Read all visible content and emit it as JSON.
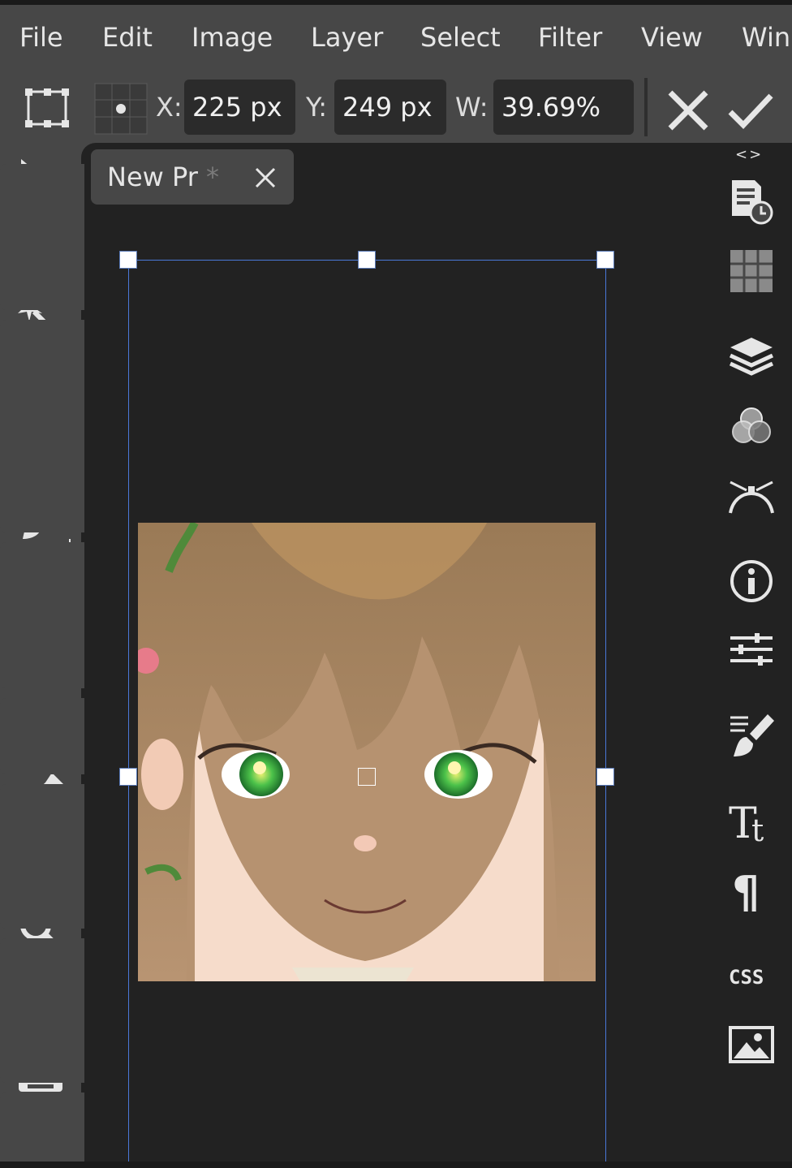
{
  "menu": {
    "items": [
      "File",
      "Edit",
      "Image",
      "Layer",
      "Select",
      "Filter",
      "View",
      "Win"
    ]
  },
  "options": {
    "x_label": "X:",
    "x_value": "225 px",
    "y_label": "Y:",
    "y_value": "249 px",
    "w_label": "W:",
    "w_value": "39.69%"
  },
  "tab": {
    "title": "New Pr",
    "modified": " *"
  },
  "right_panel": {
    "collapse": "<>"
  },
  "colors": {
    "foreground": "#000000",
    "background": "#ffffff",
    "accent": "#4a78d8"
  }
}
